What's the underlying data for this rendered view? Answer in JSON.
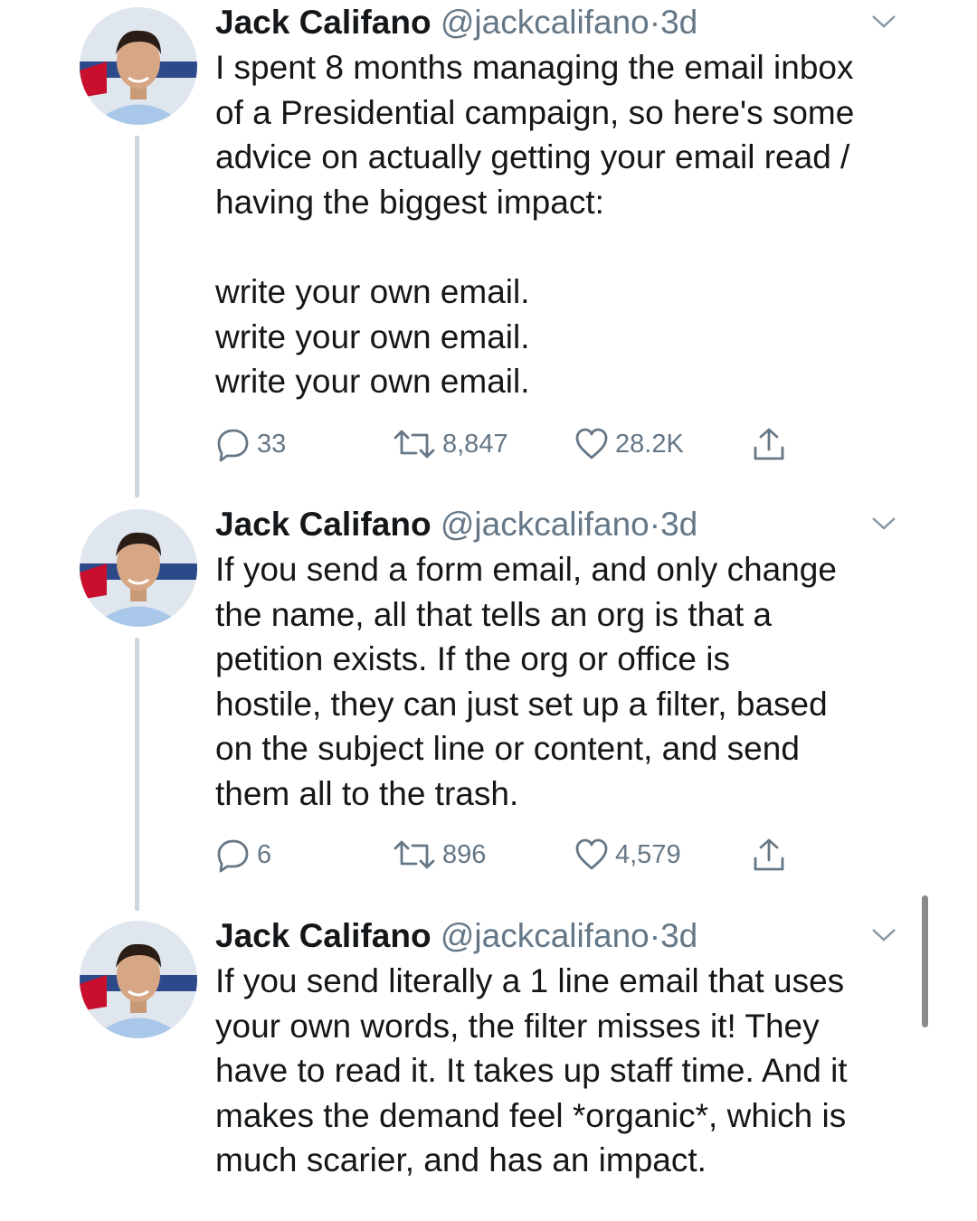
{
  "author": {
    "name": "Jack Califano",
    "handle": "@jackcalifano",
    "separator": "·",
    "time": "3d"
  },
  "icons": {
    "avatar": "profile-photo",
    "menu": "chevron-down-icon",
    "reply": "reply-bubble-icon",
    "retweet": "retweet-arrows-icon",
    "like": "heart-icon",
    "share": "share-upload-icon"
  },
  "colors": {
    "text": "#14171a",
    "muted": "#657786",
    "thread_line": "#ccd6dd"
  },
  "tweets": [
    {
      "lines": [
        "I spent 8 months managing the email inbox",
        "of a Presidential campaign, so here's some",
        "advice on actually getting your email read /",
        "having the biggest impact:",
        "",
        "write your own email.",
        "write your own email.",
        "write your own email."
      ],
      "replies": "33",
      "retweets": "8,847",
      "likes": "28.2K"
    },
    {
      "lines": [
        "If you send a form email, and only change",
        "the name, all that tells an org is that a",
        "petition exists. If the org or office is",
        "hostile, they can just set up a filter, based",
        "on the subject line or content, and send",
        "them all to the trash."
      ],
      "replies": "6",
      "retweets": "896",
      "likes": "4,579"
    },
    {
      "lines": [
        "If you send literally a 1 line email that uses",
        "your own words, the filter misses it! They",
        "have to read it. It takes up staff time. And it",
        "makes the demand feel *organic*, which is",
        "much scarier, and has an impact."
      ]
    }
  ]
}
